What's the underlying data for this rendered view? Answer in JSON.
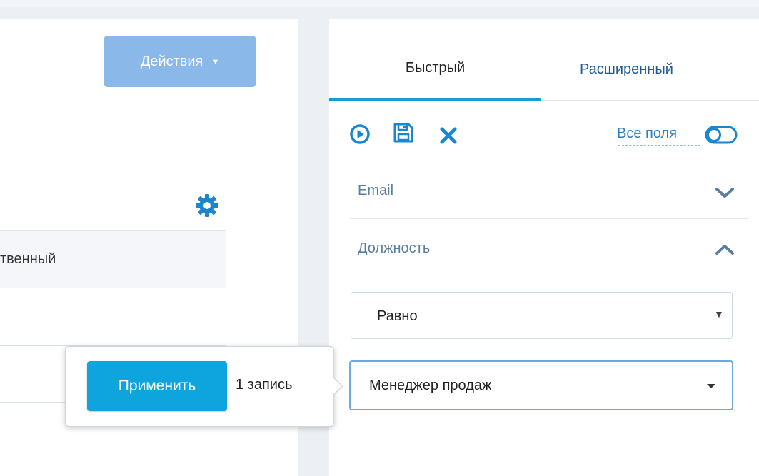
{
  "toolbar": {
    "actions_label": "Действия"
  },
  "table": {
    "header_partial": "твенный"
  },
  "filter_panel": {
    "tabs": [
      {
        "label": "Быстрый",
        "active": true
      },
      {
        "label": "Расширенный",
        "active": false
      }
    ],
    "tools": {
      "run_icon": "play-circle-icon",
      "save_icon": "floppy-disk-icon",
      "clear_icon": "close-icon",
      "all_fields_label": "Все поля",
      "all_fields_toggle_icon": "toggle-off-icon"
    },
    "sections": [
      {
        "title": "Email",
        "expanded": false,
        "chevron": "chevron-down-icon"
      },
      {
        "title": "Должность",
        "expanded": true,
        "chevron": "chevron-up-icon"
      }
    ],
    "position_filter": {
      "operator": "Равно",
      "value": "Менеджер продаж"
    }
  },
  "popover": {
    "apply_label": "Применить",
    "record_count": "1 запись"
  },
  "colors": {
    "accent": "#1a9ad6",
    "apply_button": "#0ea5de",
    "actions_button": "#8ab8e8",
    "link": "#2a7fc4",
    "section_title": "#5b7f9e"
  }
}
